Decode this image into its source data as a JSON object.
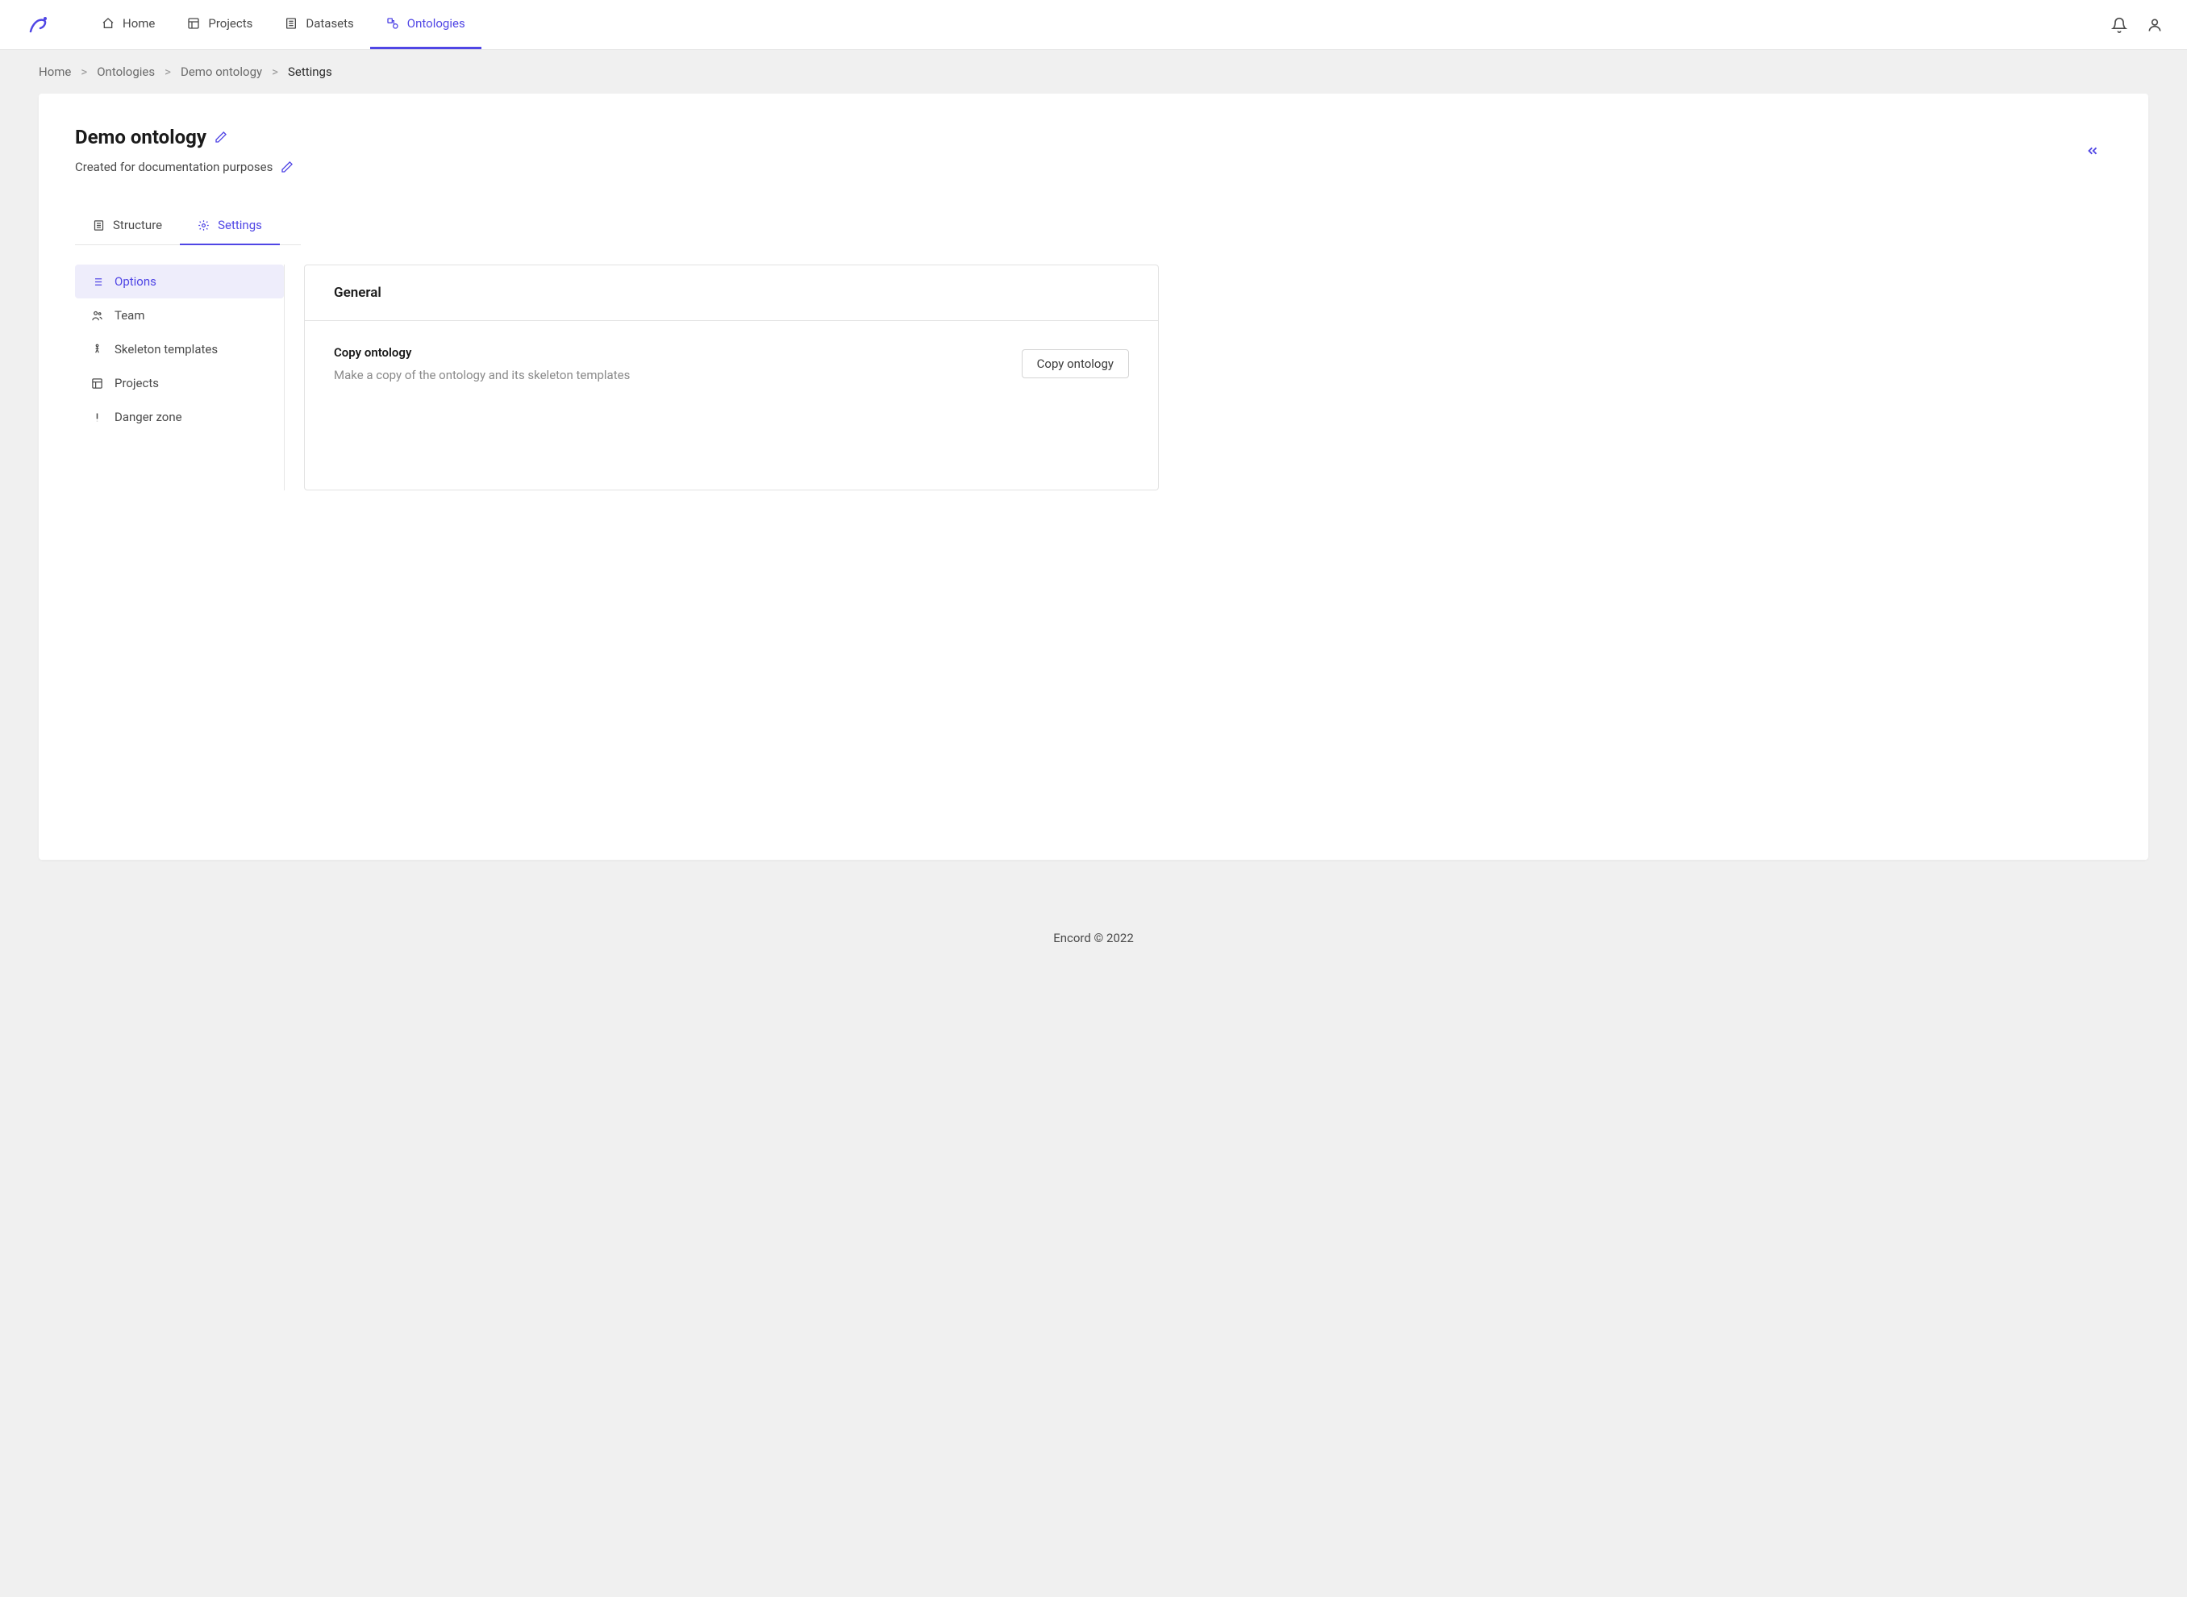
{
  "nav": {
    "items": [
      {
        "label": "Home",
        "active": false
      },
      {
        "label": "Projects",
        "active": false
      },
      {
        "label": "Datasets",
        "active": false
      },
      {
        "label": "Ontologies",
        "active": true
      }
    ]
  },
  "breadcrumb": {
    "items": [
      {
        "label": "Home"
      },
      {
        "label": "Ontologies"
      },
      {
        "label": "Demo ontology"
      },
      {
        "label": "Settings"
      }
    ]
  },
  "page": {
    "title": "Demo ontology",
    "subtitle": "Created for documentation purposes"
  },
  "tabs": [
    {
      "label": "Structure",
      "active": false
    },
    {
      "label": "Settings",
      "active": true
    }
  ],
  "sidebar": {
    "items": [
      {
        "label": "Options",
        "active": true
      },
      {
        "label": "Team",
        "active": false
      },
      {
        "label": "Skeleton templates",
        "active": false
      },
      {
        "label": "Projects",
        "active": false
      },
      {
        "label": "Danger zone",
        "active": false
      }
    ]
  },
  "panel": {
    "header": "General",
    "item_title": "Copy ontology",
    "item_desc": "Make a copy of the ontology and its skeleton templates",
    "button_label": "Copy ontology"
  },
  "footer": "Encord © 2022"
}
